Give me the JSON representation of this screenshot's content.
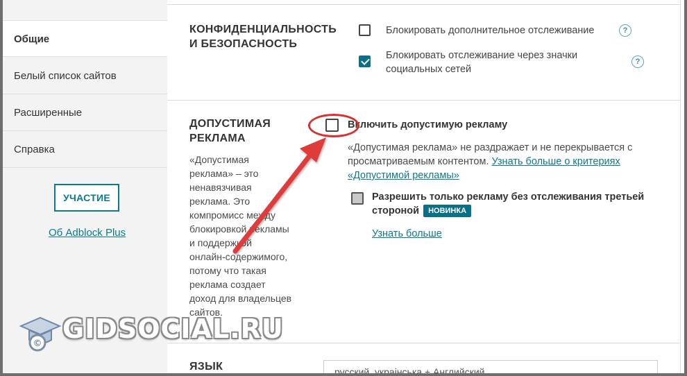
{
  "sidebar": {
    "items": [
      {
        "label": "Общие",
        "active": true
      },
      {
        "label": "Белый список сайтов",
        "active": false
      },
      {
        "label": "Расширенные",
        "active": false
      },
      {
        "label": "Справка",
        "active": false
      }
    ],
    "participate_label": "УЧАСТИЕ",
    "about_label": "Об Adblock Plus"
  },
  "privacy": {
    "title_line1": "КОНФИДЕНЦИАЛЬНОСТЬ",
    "title_line2": "И БЕЗОПАСНОСТЬ",
    "options": [
      {
        "label": "Блокировать дополнительное отслеживание",
        "checked": false,
        "help": "?"
      },
      {
        "label_line1": "Блокировать отслеживание через значки",
        "label_line2": "социальных сетей",
        "checked": true,
        "help": "?"
      }
    ]
  },
  "acceptable_ads": {
    "title_line1": "ДОПУСТИМАЯ",
    "title_line2": "РЕКЛАМА",
    "description_lines": [
      "«Допустимая",
      "реклама» – это",
      "ненавязчивая",
      "реклама. Это",
      "компромисс между",
      "блокировкой рекламы",
      "и поддержкой",
      "онлайн-содержимого,",
      "потому что такая",
      "реклама создает",
      "доход для владельцев",
      "сайтов."
    ],
    "enable_label": "Включить допустимую рекламу",
    "enable_checked": false,
    "info_line1": "«Допустимая реклама» не раздражает и не перекрывается с",
    "info_line2_prefix": "просматриваемым контентом.",
    "info_link_part1": "Узнать больше о критериях",
    "info_link_part2": "«Допустимой рекламы»",
    "privacy_friendly_line1": "Разрешить только рекламу без отслеживания третьей",
    "privacy_friendly_line2": "стороной",
    "new_badge": "НОВИНКА",
    "learn_more": "Узнать больше"
  },
  "language": {
    "title": "ЯЗЫК",
    "value": "русский, украінська + Английский"
  },
  "watermark": {
    "text": "GIDSOCIAL.RU"
  },
  "colors": {
    "accent": "#0b6f87",
    "link": "#0a7a8c",
    "annotation_red": "#d93030"
  }
}
